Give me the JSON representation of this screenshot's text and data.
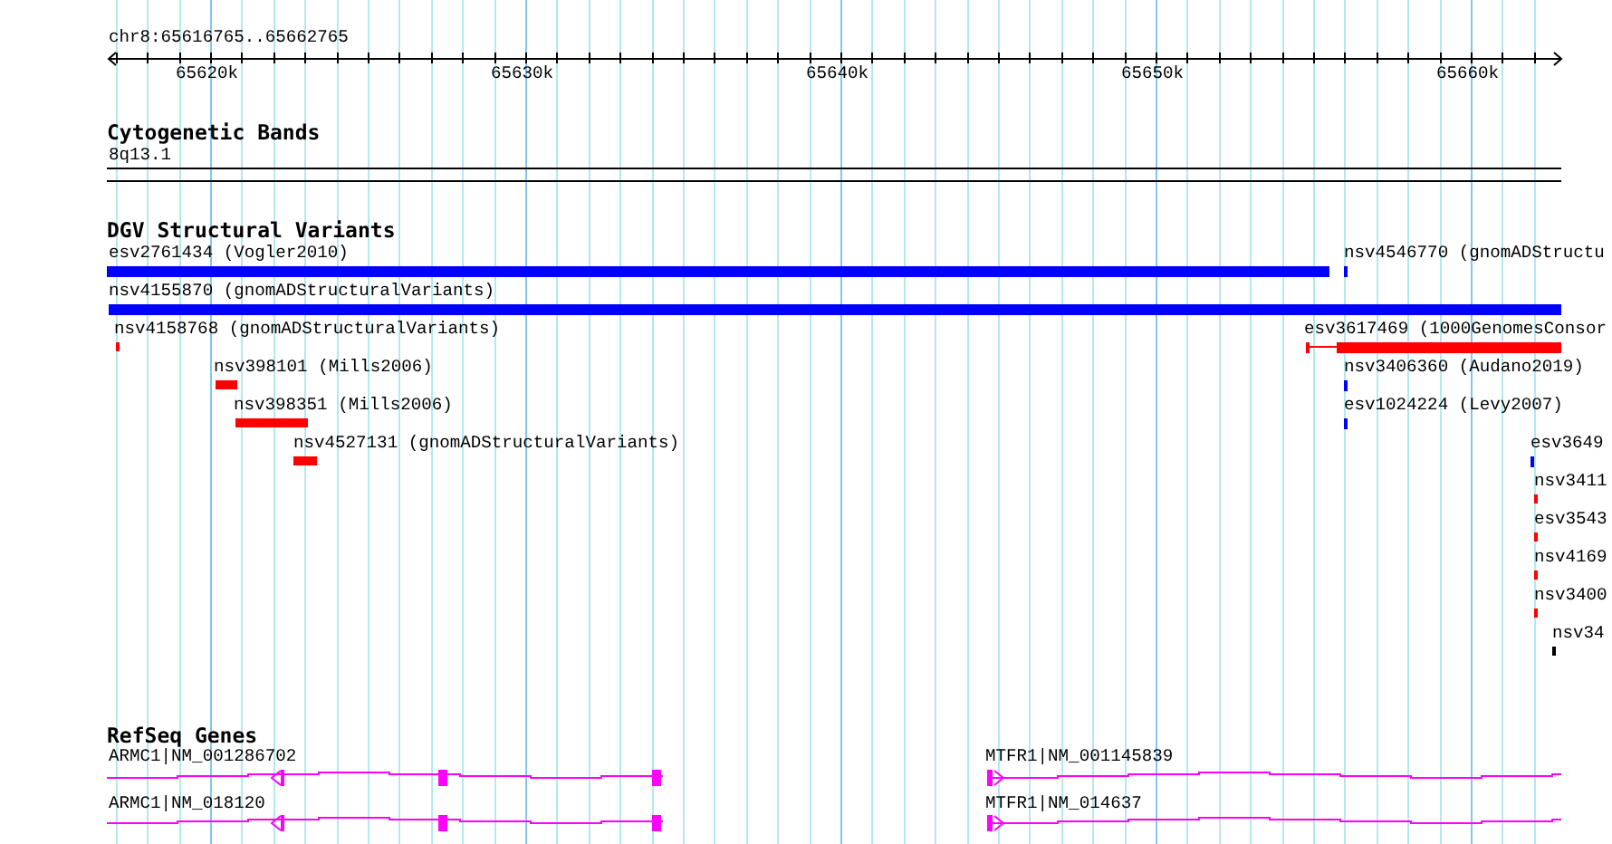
{
  "ruler": {
    "location": "chr8:65616765..65662765",
    "tick_labels": [
      "65620k",
      "65630k",
      "65640k",
      "65650k",
      "65660k"
    ]
  },
  "tracks": [
    {
      "kind": "bands",
      "title": "Cytogenetic Bands",
      "band": "8q13.1"
    },
    {
      "kind": "variants",
      "title": "DGV Structural Variants",
      "features": [
        {
          "label": "esv2761434 (Vogler2010)",
          "color": "#0000ff",
          "kind": "bar"
        },
        {
          "label": "nsv4546770 (gnomADStructu",
          "color": "#0000ff",
          "kind": "bar"
        },
        {
          "label": "nsv4155870 (gnomADStructuralVariants)",
          "color": "#0000ff",
          "kind": "bar"
        },
        {
          "label": "nsv4158768 (gnomADStructuralVariants)",
          "color": "#ff0000",
          "kind": "bar"
        },
        {
          "label": "esv3617469 (1000GenomesConsor",
          "color": "#ff0000",
          "kind": "gapped"
        },
        {
          "label": "nsv398101 (Mills2006)",
          "color": "#ff0000",
          "kind": "bar"
        },
        {
          "label": "nsv3406360 (Audano2019)",
          "color": "#0000ff",
          "kind": "bar"
        },
        {
          "label": "nsv398351 (Mills2006)",
          "color": "#ff0000",
          "kind": "bar"
        },
        {
          "label": "esv1024224 (Levy2007)",
          "color": "#0000ff",
          "kind": "bar"
        },
        {
          "label": "nsv4527131 (gnomADStructuralVariants)",
          "color": "#ff0000",
          "kind": "bar"
        },
        {
          "label": "esv3649",
          "color": "#0000ff",
          "kind": "bar"
        },
        {
          "label": "nsv3411",
          "color": "#ff0000",
          "kind": "bar"
        },
        {
          "label": "esv3543",
          "color": "#ff0000",
          "kind": "bar"
        },
        {
          "label": "nsv4169",
          "color": "#ff0000",
          "kind": "bar"
        },
        {
          "label": "nsv3400",
          "color": "#ff0000",
          "kind": "bar"
        },
        {
          "label": "nsv34",
          "color": "#000000",
          "kind": "bar"
        }
      ]
    },
    {
      "kind": "genes",
      "title": "RefSeq Genes",
      "transcripts": [
        {
          "label": "ARMC1|NM_001286702",
          "kind": "reverse"
        },
        {
          "label": "MTFR1|NM_001145839",
          "kind": "forward"
        },
        {
          "label": "ARMC1|NM_018120",
          "kind": "reverse"
        },
        {
          "label": "MTFR1|NM_014637",
          "kind": "forward"
        }
      ]
    }
  ]
}
